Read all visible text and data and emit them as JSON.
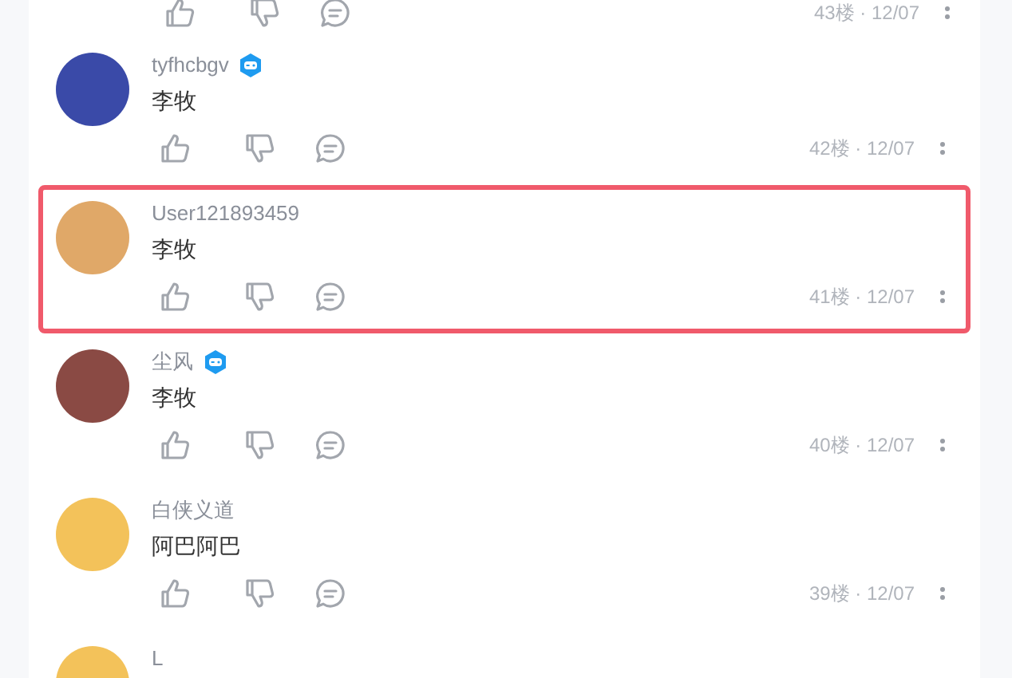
{
  "partial_top": {
    "floor": "43楼",
    "separator": "·",
    "date": "12/07"
  },
  "comments": [
    {
      "user": "tyfhcbgv",
      "badge": true,
      "text": "李牧",
      "floor": "42楼",
      "separator": "·",
      "date": "12/07",
      "highlighted": false
    },
    {
      "user": "User121893459",
      "badge": false,
      "text": "李牧",
      "floor": "41楼",
      "separator": "·",
      "date": "12/07",
      "highlighted": true
    },
    {
      "user": "尘风",
      "badge": true,
      "text": "李牧",
      "floor": "40楼",
      "separator": "·",
      "date": "12/07",
      "highlighted": false
    },
    {
      "user": "白侠义道",
      "badge": false,
      "text": "阿巴阿巴",
      "floor": "39楼",
      "separator": "·",
      "date": "12/07",
      "highlighted": false
    },
    {
      "user": "L",
      "badge": false,
      "highlighted": false
    }
  ]
}
